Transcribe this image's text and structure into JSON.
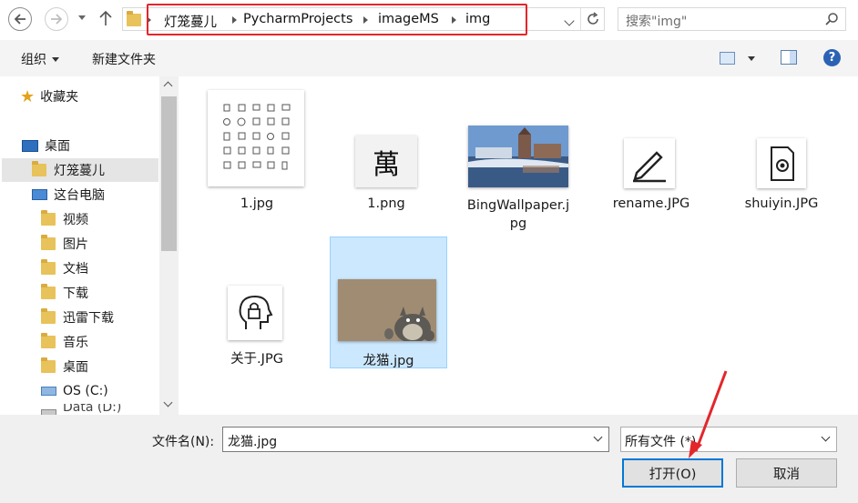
{
  "breadcrumb": {
    "items": [
      "灯笼蔓儿",
      "PycharmProjects",
      "imageMS",
      "img"
    ]
  },
  "search": {
    "placeholder": "搜索\"img\""
  },
  "toolbar": {
    "organize": "组织",
    "new_folder": "新建文件夹"
  },
  "sidebar": {
    "favorites": "收藏夹",
    "desktop": "桌面",
    "user": "灯笼蔓儿",
    "thispc": "这台电脑",
    "items": [
      "视频",
      "图片",
      "文档",
      "下载",
      "迅雷下载",
      "音乐",
      "桌面"
    ],
    "drive_c": "OS (C:)",
    "drive_d": "Data (D:)"
  },
  "files": [
    {
      "name": "1.jpg"
    },
    {
      "name": "1.png"
    },
    {
      "name_line1": "BingWallpaper.j",
      "name_line2": "pg"
    },
    {
      "name": "rename.JPG"
    },
    {
      "name": "shuiyin.JPG"
    },
    {
      "name": "关于.JPG"
    },
    {
      "name": "龙猫.jpg"
    }
  ],
  "thumb_text": {
    "wan": "萬"
  },
  "bottom": {
    "filename_label": "文件名(N):",
    "filename_value": "龙猫.jpg",
    "filetype_value": "所有文件 (*)",
    "open_button": "打开(O)",
    "cancel_button": "取消"
  },
  "colors": {
    "selection": "#cce8ff",
    "selection_border": "#99d1ff",
    "annotation": "#e3262b",
    "accent": "#1f62b0"
  }
}
